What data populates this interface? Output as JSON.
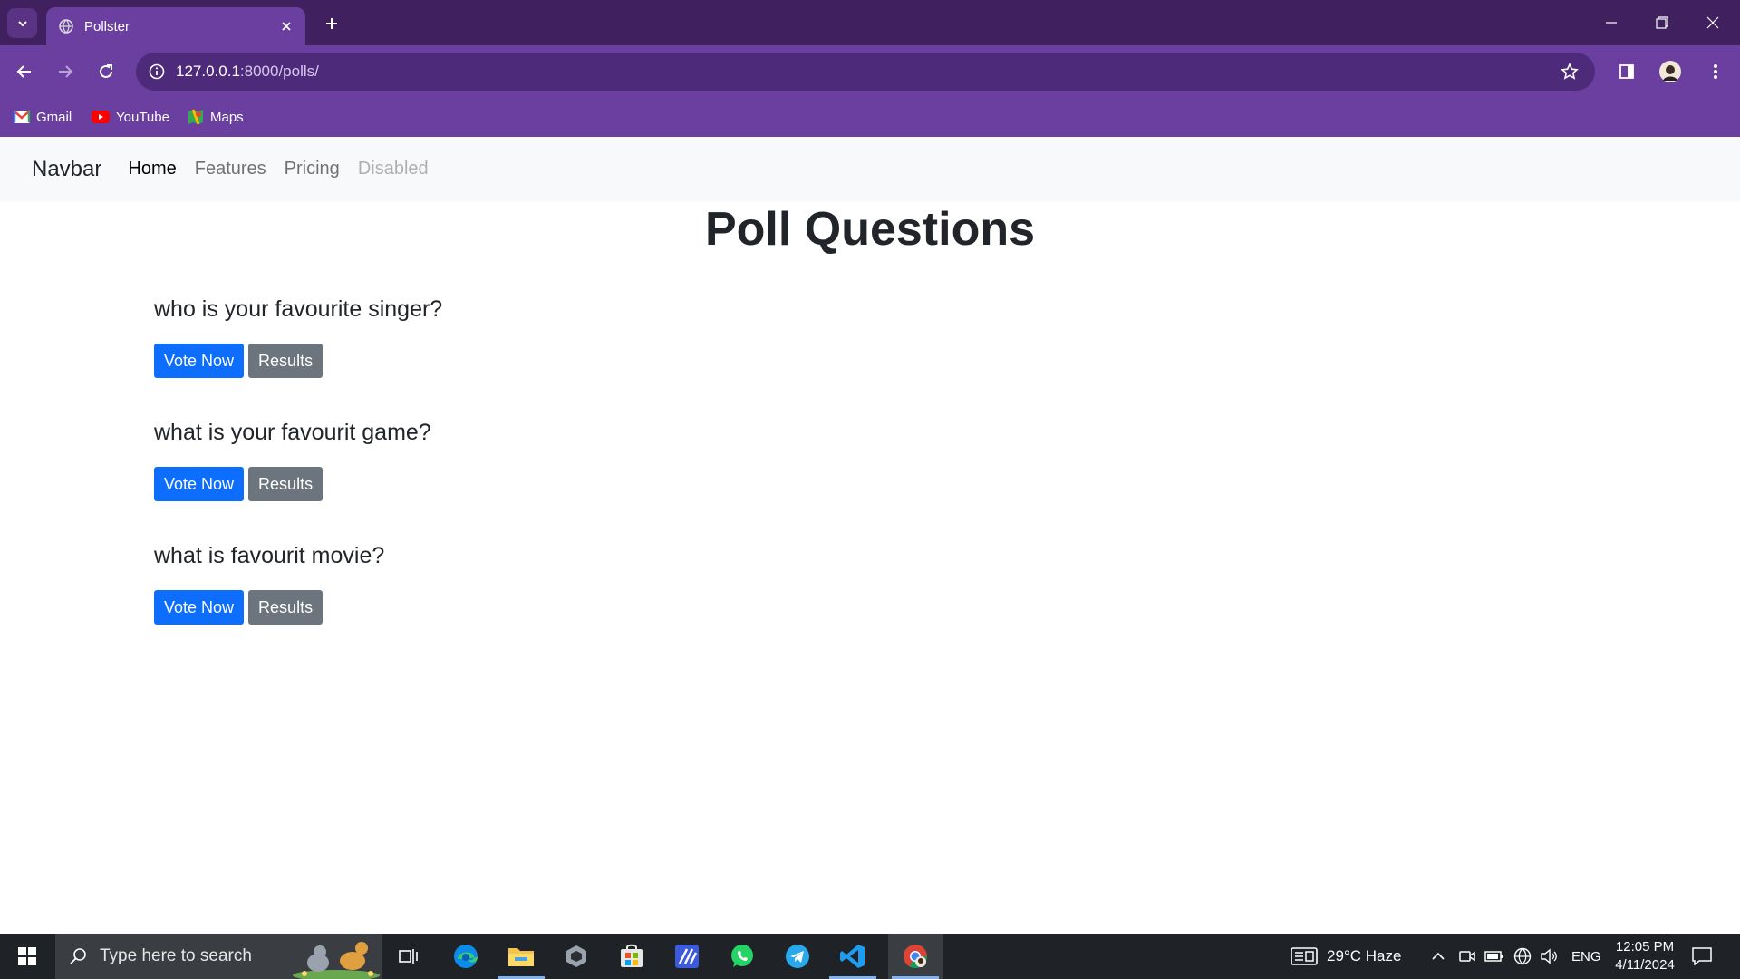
{
  "browser": {
    "tab_title": "Pollster",
    "url_host": "127.0.0.1",
    "url_path": ":8000/polls/",
    "bookmarks": [
      {
        "label": "Gmail",
        "icon": "gmail-icon"
      },
      {
        "label": "YouTube",
        "icon": "youtube-icon"
      },
      {
        "label": "Maps",
        "icon": "maps-icon"
      }
    ]
  },
  "navbar": {
    "brand": "Navbar",
    "links": [
      {
        "label": "Home",
        "state": "active"
      },
      {
        "label": "Features",
        "state": "normal"
      },
      {
        "label": "Pricing",
        "state": "normal"
      },
      {
        "label": "Disabled",
        "state": "disabled"
      }
    ]
  },
  "main": {
    "title": "Poll Questions",
    "polls": [
      {
        "question": "who is your favourite singer?",
        "vote_label": "Vote Now",
        "results_label": "Results"
      },
      {
        "question": "what is your favourit game?",
        "vote_label": "Vote Now",
        "results_label": "Results"
      },
      {
        "question": "what is favourit movie?",
        "vote_label": "Vote Now",
        "results_label": "Results"
      }
    ]
  },
  "taskbar": {
    "search_placeholder": "Type here to search",
    "weather": "29°C  Haze",
    "language": "ENG",
    "time": "12:05 PM",
    "date": "4/11/2024"
  },
  "colors": {
    "tabbar": "#41205f",
    "toolbar": "#6b3fa0",
    "primary": "#0d6efd",
    "secondary": "#6c757d",
    "taskbar": "#1f2328"
  }
}
